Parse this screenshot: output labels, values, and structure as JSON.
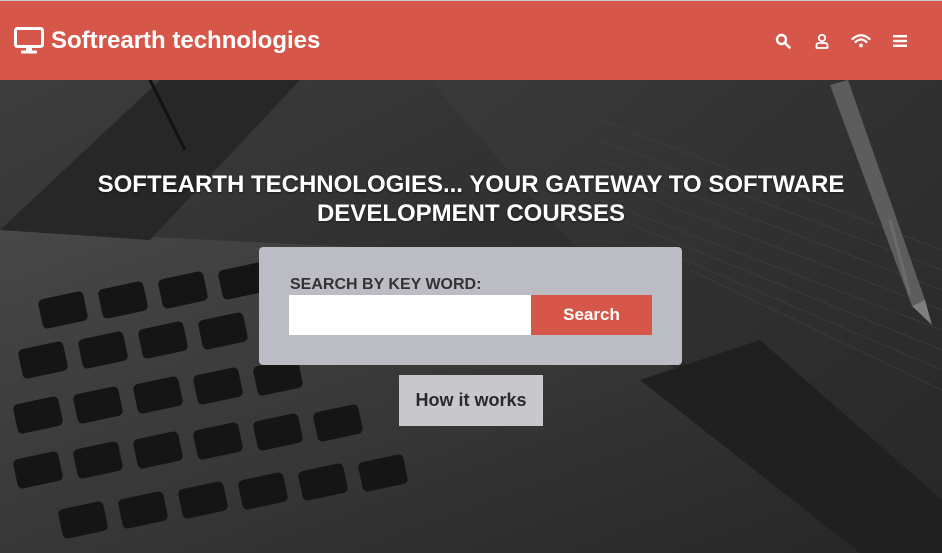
{
  "header": {
    "brand_name": "Softrearth technologies",
    "brand_icon": "monitor-icon",
    "nav_icons": [
      "search-icon",
      "user-icon",
      "wifi-icon",
      "menu-icon"
    ]
  },
  "hero": {
    "headline": "SOFTEARTH TECHNOLOGIES... YOUR GATEWAY TO SOFTWARE DEVELOPMENT COURSES",
    "search": {
      "label": "SEARCH BY KEY WORD:",
      "input_value": "",
      "placeholder": "",
      "button_label": "Search"
    },
    "how_button_label": "How it works"
  },
  "colors": {
    "brand": "#d6574a",
    "panel": "#bcbcc4",
    "secondary_button": "#c8c8cc",
    "text_on_brand": "#ffffff"
  }
}
